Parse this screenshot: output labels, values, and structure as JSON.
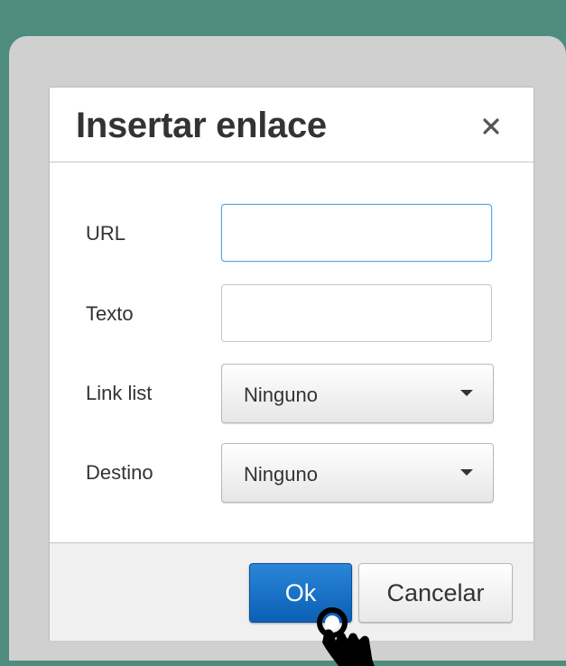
{
  "dialog": {
    "title": "Insertar enlace",
    "close_icon": "close-icon"
  },
  "form": {
    "url": {
      "label": "URL",
      "value": "",
      "placeholder": ""
    },
    "text": {
      "label": "Texto",
      "value": "",
      "placeholder": ""
    },
    "link_list": {
      "label": "Link list",
      "selected": "Ninguno",
      "icon": "chevron-down-icon"
    },
    "target": {
      "label": "Destino",
      "selected": "Ninguno",
      "icon": "chevron-down-icon"
    }
  },
  "buttons": {
    "ok": "Ok",
    "cancel": "Cancelar"
  },
  "cursor": {
    "icon": "pointer-hand-icon"
  },
  "colors": {
    "background": "#4e8c7d",
    "frame": "#d0d0d0",
    "primary_button": "#1a73c9",
    "focus_border": "#59a5e5"
  }
}
